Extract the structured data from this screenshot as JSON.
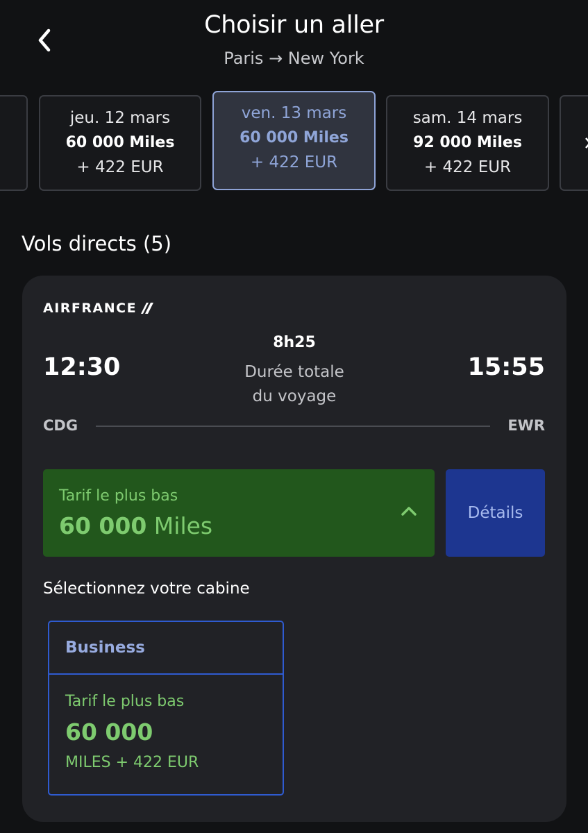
{
  "header": {
    "title": "Choisir un aller",
    "route": "Paris → New York"
  },
  "dates": [
    {
      "date": "",
      "miles": "",
      "eur": ""
    },
    {
      "date": "jeu. 12 mars",
      "miles": "60 000 Miles",
      "eur": "+ 422 EUR"
    },
    {
      "date": "ven. 13 mars",
      "miles": "60 000 Miles",
      "eur": "+ 422 EUR",
      "selected": true
    },
    {
      "date": "sam. 14 mars",
      "miles": "92 000 Miles",
      "eur": "+ 422 EUR"
    },
    {
      "date": "",
      "miles": "",
      "eur": ""
    }
  ],
  "section": {
    "title": "Vols directs (5)"
  },
  "flight": {
    "airline": "AIRFRANCE",
    "departure_time": "12:30",
    "arrival_time": "15:55",
    "duration": "8h25",
    "duration_label_line1": "Durée totale",
    "duration_label_line2": "du voyage",
    "departure_airport": "CDG",
    "arrival_airport": "EWR",
    "fare_label": "Tarif le plus bas",
    "fare_amount": "60 000",
    "fare_unit": "Miles",
    "details_label": "Détails",
    "cabin_prompt": "Sélectionnez votre cabine",
    "cabin": {
      "name": "Business",
      "fare_label": "Tarif le plus bas",
      "amount": "60 000",
      "sub": "MILES + 422 EUR"
    }
  },
  "colors": {
    "background": "#111214",
    "card": "#212226",
    "selected_date_accent": "#8fa5d8",
    "fare_green_bg": "#22571c",
    "fare_green_text": "#7ecb6f",
    "details_blue": "#1d3690",
    "cabin_border": "#2f5bd0"
  }
}
